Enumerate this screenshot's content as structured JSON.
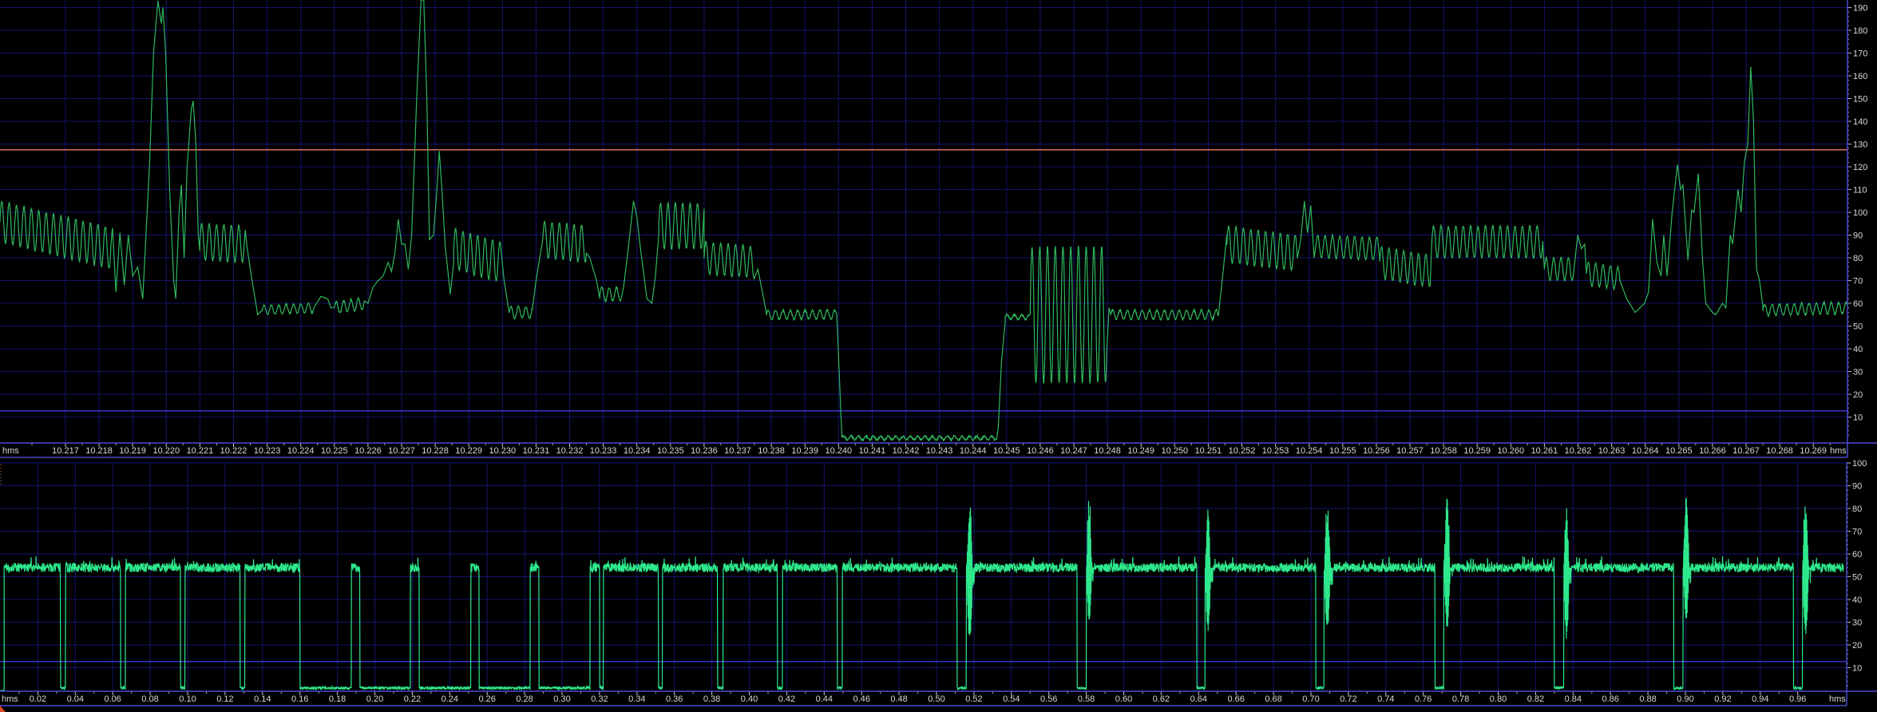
{
  "chart_data": [
    {
      "type": "line",
      "name": "upper-trace",
      "xlabel": "hms",
      "xunit_label_left": "hms",
      "xunit_label_right": "hms",
      "xlim": [
        10.21505,
        10.27002
      ],
      "ylim": [
        0,
        192
      ],
      "x_tick_labels": [
        "10.217",
        "10.218",
        "10.219",
        "10.220",
        "10.221",
        "10.222",
        "10.223",
        "10.224",
        "10.225",
        "10.226",
        "10.227",
        "10.228",
        "10.229",
        "10.230",
        "10.231",
        "10.232",
        "10.233",
        "10.234",
        "10.235",
        "10.236",
        "10.237",
        "10.238",
        "10.239",
        "10.240",
        "10.241",
        "10.242",
        "10.243",
        "10.244",
        "10.245",
        "10.246",
        "10.247",
        "10.248",
        "10.249",
        "10.250",
        "10.251",
        "10.252",
        "10.253",
        "10.254",
        "10.255",
        "10.256",
        "10.257",
        "10.258",
        "10.259",
        "10.260",
        "10.261",
        "10.262",
        "10.263",
        "10.264",
        "10.265",
        "10.266",
        "10.267",
        "10.268",
        "10.269"
      ],
      "y_tick_labels": [
        "10",
        "20",
        "30",
        "40",
        "50",
        "60",
        "70",
        "80",
        "90",
        "100",
        "110",
        "120",
        "130",
        "140",
        "150",
        "160",
        "170",
        "180",
        "190"
      ],
      "grid": true,
      "threshold_lines": [
        {
          "value": 127.5,
          "color": "#e07a5f"
        },
        {
          "value": 12.7,
          "color": "#3434c8"
        }
      ],
      "trace_color": "#2fb85c",
      "segments": [
        {
          "type": "osc",
          "t0": 10.21505,
          "t1": 10.2184,
          "c0": 96,
          "c1": 84,
          "amp": 9,
          "period": 0.00022
        },
        {
          "type": "pts",
          "points": [
            [
              10.2185,
              65
            ],
            [
              10.21862,
              91
            ],
            [
              10.21875,
              68
            ],
            [
              10.21887,
              90
            ],
            [
              10.219,
              72
            ],
            [
              10.21915,
              76
            ],
            [
              10.2193,
              62
            ],
            [
              10.2195,
              120
            ],
            [
              10.21962,
              170
            ],
            [
              10.21975,
              193
            ],
            [
              10.21985,
              183
            ],
            [
              10.2199,
              190
            ],
            [
              10.21998,
              170
            ],
            [
              10.2201,
              110
            ],
            [
              10.22022,
              70
            ],
            [
              10.22028,
              62
            ],
            [
              10.22038,
              100
            ],
            [
              10.22045,
              112
            ],
            [
              10.22053,
              80
            ],
            [
              10.22062,
              120
            ],
            [
              10.22074,
              145
            ],
            [
              10.2208,
              149
            ],
            [
              10.22088,
              130
            ],
            [
              10.22095,
              90
            ],
            [
              10.221,
              83
            ]
          ]
        },
        {
          "type": "osc",
          "t0": 10.221,
          "t1": 10.22235,
          "c0": 87,
          "c1": 86,
          "amp": 8,
          "period": 0.00022
        },
        {
          "type": "pts",
          "points": [
            [
              10.2224,
              85
            ],
            [
              10.22255,
              70
            ],
            [
              10.22272,
              55
            ],
            [
              10.22285,
              57
            ]
          ]
        },
        {
          "type": "osc",
          "t0": 10.22285,
          "t1": 10.2244,
          "c0": 57,
          "c1": 58,
          "amp": 2,
          "period": 0.00022
        },
        {
          "type": "pts",
          "points": [
            [
              10.2246,
              63
            ],
            [
              10.2248,
              62
            ],
            [
              10.2249,
              58
            ]
          ]
        },
        {
          "type": "osc",
          "t0": 10.225,
          "t1": 10.2259,
          "c0": 58,
          "c1": 60,
          "amp": 2.5,
          "period": 0.00022
        },
        {
          "type": "pts",
          "points": [
            [
              10.226,
              60
            ],
            [
              10.22615,
              67
            ],
            [
              10.2263,
              70
            ],
            [
              10.22645,
              72
            ],
            [
              10.2266,
              78
            ],
            [
              10.2267,
              74
            ],
            [
              10.2268,
              82
            ],
            [
              10.2269,
              97
            ],
            [
              10.227,
              86
            ],
            [
              10.2271,
              86
            ],
            [
              10.2272,
              75
            ],
            [
              10.2273,
              90
            ],
            [
              10.22745,
              150
            ],
            [
              10.22758,
              200
            ],
            [
              10.22766,
              200
            ],
            [
              10.22775,
              150
            ],
            [
              10.22783,
              88
            ],
            [
              10.22795,
              90
            ],
            [
              10.22805,
              110
            ],
            [
              10.22812,
              127
            ],
            [
              10.2282,
              110
            ],
            [
              10.2283,
              85
            ],
            [
              10.22845,
              64
            ],
            [
              10.22855,
              78
            ]
          ]
        },
        {
          "type": "osc",
          "t0": 10.22855,
          "t1": 10.22995,
          "c0": 84,
          "c1": 78,
          "amp": 9,
          "period": 0.00022
        },
        {
          "type": "pts",
          "points": [
            [
              10.23005,
              70
            ],
            [
              10.2302,
              56
            ]
          ]
        },
        {
          "type": "osc",
          "t0": 10.2302,
          "t1": 10.2309,
          "c0": 56,
          "c1": 56,
          "amp": 2.5,
          "period": 0.00022
        },
        {
          "type": "pts",
          "points": [
            [
              10.231,
              70
            ],
            [
              10.2312,
              88
            ]
          ]
        },
        {
          "type": "osc",
          "t0": 10.2312,
          "t1": 10.2325,
          "c0": 88,
          "c1": 86,
          "amp": 8,
          "period": 0.00022
        },
        {
          "type": "pts",
          "points": [
            [
              10.2326,
              80
            ],
            [
              10.2328,
              70
            ],
            [
              10.2329,
              62
            ]
          ]
        },
        {
          "type": "osc",
          "t0": 10.2329,
          "t1": 10.2336,
          "c0": 64,
          "c1": 64,
          "amp": 3,
          "period": 0.00022
        },
        {
          "type": "pts",
          "points": [
            [
              10.23375,
              85
            ],
            [
              10.2339,
              105
            ],
            [
              10.234,
              98
            ],
            [
              10.2341,
              85
            ],
            [
              10.2343,
              62
            ],
            [
              10.23445,
              60
            ],
            [
              10.23455,
              72
            ],
            [
              10.23465,
              90
            ]
          ]
        },
        {
          "type": "osc",
          "t0": 10.23465,
          "t1": 10.236,
          "c0": 94,
          "c1": 94,
          "amp": 10,
          "period": 0.00022
        },
        {
          "type": "osc",
          "t0": 10.236,
          "t1": 10.2375,
          "c0": 80,
          "c1": 78,
          "amp": 7,
          "period": 0.00022
        },
        {
          "type": "pts",
          "points": [
            [
              10.2376,
              75
            ],
            [
              10.23785,
              56
            ]
          ]
        },
        {
          "type": "osc",
          "t0": 10.23785,
          "t1": 10.23995,
          "c0": 55,
          "c1": 55,
          "amp": 2,
          "period": 0.00022
        },
        {
          "type": "pts",
          "points": [
            [
              10.2401,
              1
            ]
          ]
        },
        {
          "type": "osc",
          "t0": 10.2401,
          "t1": 10.2447,
          "c0": 0.8,
          "c1": 0.8,
          "amp": 0.8,
          "period": 0.00022
        },
        {
          "type": "pts",
          "points": [
            [
              10.24475,
              5
            ],
            [
              10.24485,
              35
            ],
            [
              10.24496,
              52
            ]
          ]
        },
        {
          "type": "osc",
          "t0": 10.24496,
          "t1": 10.24565,
          "c0": 54,
          "c1": 54,
          "amp": 1,
          "period": 0.00022
        },
        {
          "type": "osc",
          "t0": 10.2457,
          "t1": 10.24798,
          "c0": 55,
          "c1": 55,
          "amp": 30,
          "period": 0.00023
        },
        {
          "type": "pts",
          "points": [
            [
              10.24805,
              58
            ]
          ]
        },
        {
          "type": "osc",
          "t0": 10.2481,
          "t1": 10.2513,
          "c0": 55,
          "c1": 55,
          "amp": 2,
          "period": 0.00022
        },
        {
          "type": "pts",
          "points": [
            [
              10.25145,
              75
            ],
            [
              10.25155,
              90
            ]
          ]
        },
        {
          "type": "osc",
          "t0": 10.25155,
          "t1": 10.25365,
          "c0": 86,
          "c1": 82,
          "amp": 8,
          "period": 0.00022
        },
        {
          "type": "pts",
          "points": [
            [
              10.25375,
              88
            ],
            [
              10.25386,
              105
            ],
            [
              10.25395,
              91
            ],
            [
              10.25405,
              103
            ],
            [
              10.25415,
              80
            ]
          ]
        },
        {
          "type": "osc",
          "t0": 10.2542,
          "t1": 10.2561,
          "c0": 85,
          "c1": 84,
          "amp": 5,
          "period": 0.00022
        },
        {
          "type": "osc",
          "t0": 10.2561,
          "t1": 10.2576,
          "c0": 78,
          "c1": 74,
          "amp": 7,
          "period": 0.00022
        },
        {
          "type": "osc",
          "t0": 10.25765,
          "t1": 10.26095,
          "c0": 87,
          "c1": 87,
          "amp": 7,
          "period": 0.00022
        },
        {
          "type": "osc",
          "t0": 10.261,
          "t1": 10.2619,
          "c0": 75,
          "c1": 75,
          "amp": 5,
          "period": 0.00022
        },
        {
          "type": "pts",
          "points": [
            [
              10.26199,
              90
            ],
            [
              10.2621,
              84
            ],
            [
              10.2622,
              86
            ]
          ]
        },
        {
          "type": "osc",
          "t0": 10.26225,
          "t1": 10.26325,
          "c0": 73,
          "c1": 71,
          "amp": 5,
          "period": 0.00022
        },
        {
          "type": "pts",
          "points": [
            [
              10.26345,
              62
            ],
            [
              10.2637,
              56
            ],
            [
              10.26398,
              60
            ],
            [
              10.2641,
              65
            ],
            [
              10.26422,
              97
            ],
            [
              10.26435,
              78
            ],
            [
              10.26447,
              72
            ],
            [
              10.26455,
              90
            ],
            [
              10.26465,
              72
            ],
            [
              10.2648,
              100
            ],
            [
              10.26496,
              121
            ],
            [
              10.26505,
              110
            ],
            [
              10.26512,
              112
            ],
            [
              10.26527,
              79
            ],
            [
              10.26538,
              101
            ],
            [
              10.26545,
              100
            ],
            [
              10.26558,
              117
            ],
            [
              10.2657,
              80
            ],
            [
              10.2658,
              60
            ],
            [
              10.266,
              56
            ],
            [
              10.2661,
              55
            ],
            [
              10.2663,
              60
            ],
            [
              10.2664,
              58
            ],
            [
              10.26653,
              90
            ],
            [
              10.2666,
              86
            ],
            [
              10.26676,
              110
            ],
            [
              10.26685,
              100
            ],
            [
              10.26695,
              122
            ],
            [
              10.26705,
              130
            ],
            [
              10.26714,
              164
            ],
            [
              10.26722,
              140
            ],
            [
              10.26731,
              75
            ],
            [
              10.2674,
              70
            ],
            [
              10.2675,
              59
            ]
          ]
        },
        {
          "type": "osc",
          "t0": 10.2675,
          "t1": 10.27002,
          "c0": 57,
          "c1": 58,
          "amp": 2.5,
          "period": 0.00022
        }
      ]
    },
    {
      "type": "line",
      "name": "lower-trace",
      "xlabel": "hms",
      "xunit_label_left": "hms",
      "xunit_label_right": "hms",
      "xlim": [
        0.0,
        0.9865
      ],
      "ylim": [
        0,
        100
      ],
      "x_tick_labels": [
        "0.02",
        "0.04",
        "0.06",
        "0.08",
        "0.10",
        "0.12",
        "0.14",
        "0.16",
        "0.18",
        "0.20",
        "0.22",
        "0.24",
        "0.26",
        "0.28",
        "0.30",
        "0.32",
        "0.34",
        "0.36",
        "0.38",
        "0.40",
        "0.42",
        "0.44",
        "0.46",
        "0.48",
        "0.50",
        "0.52",
        "0.54",
        "0.56",
        "0.58",
        "0.60",
        "0.62",
        "0.64",
        "0.66",
        "0.68",
        "0.70",
        "0.72",
        "0.74",
        "0.76",
        "0.78",
        "0.80",
        "0.82",
        "0.84",
        "0.86",
        "0.88",
        "0.90",
        "0.92",
        "0.94",
        "0.96"
      ],
      "y_tick_labels": [
        "10",
        "20",
        "30",
        "40",
        "50",
        "60",
        "70",
        "80",
        "90",
        "100"
      ],
      "grid": true,
      "threshold_lines": [
        {
          "value": 12.7,
          "color": "#3434c8"
        }
      ],
      "trace_color": "#2ee88c",
      "start": 0.002,
      "end": 0.9845,
      "high_level": 54,
      "high_noise": 2,
      "low_level": 0.5,
      "low_intervals": [
        [
          0.032,
          0.0348
        ],
        [
          0.0642,
          0.0668
        ],
        [
          0.0962,
          0.0986
        ],
        [
          0.128,
          0.1306
        ],
        [
          0.16,
          0.1875
        ],
        [
          0.192,
          0.219
        ],
        [
          0.2237,
          0.2513
        ],
        [
          0.2556,
          0.283
        ],
        [
          0.2876,
          0.315
        ],
        [
          0.32,
          0.322
        ],
        [
          0.3514,
          0.3536
        ],
        [
          0.383,
          0.386
        ],
        [
          0.415,
          0.4177
        ],
        [
          0.447,
          0.4497
        ],
        [
          0.511,
          0.516
        ],
        [
          0.575,
          0.58
        ],
        [
          0.639,
          0.6435
        ],
        [
          0.7025,
          0.707
        ],
        [
          0.7663,
          0.771
        ],
        [
          0.83,
          0.835
        ],
        [
          0.8938,
          0.8988
        ],
        [
          0.9577,
          0.9625
        ]
      ],
      "bursts": [
        {
          "t0": 0.516,
          "t1": 0.5205,
          "max": 85,
          "min": 20
        },
        {
          "t0": 0.58,
          "t1": 0.584,
          "max": 88,
          "min": 30
        },
        {
          "t0": 0.6435,
          "t1": 0.6475,
          "max": 82,
          "min": 24
        },
        {
          "t0": 0.707,
          "t1": 0.7115,
          "max": 84,
          "min": 25
        },
        {
          "t0": 0.771,
          "t1": 0.7755,
          "max": 86,
          "min": 27
        },
        {
          "t0": 0.835,
          "t1": 0.839,
          "max": 81,
          "min": 22
        },
        {
          "t0": 0.8988,
          "t1": 0.903,
          "max": 87,
          "min": 31
        },
        {
          "t0": 0.9625,
          "t1": 0.967,
          "max": 85,
          "min": 24
        }
      ]
    }
  ]
}
